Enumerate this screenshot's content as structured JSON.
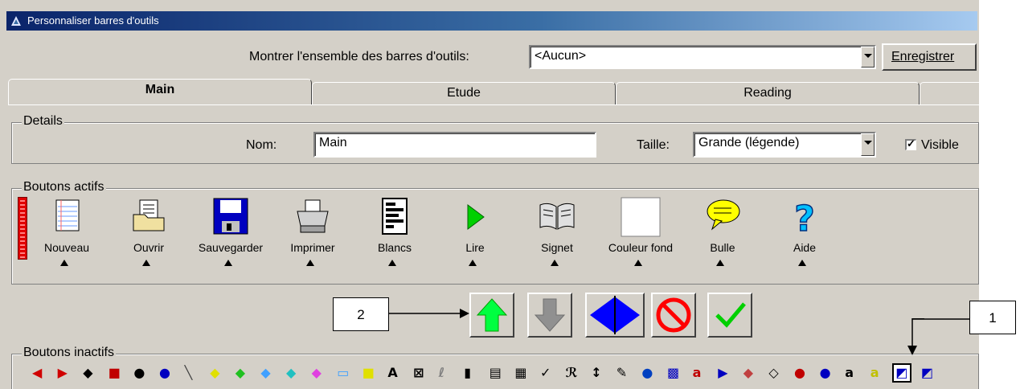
{
  "window": {
    "title": "Personnaliser barres d'outils"
  },
  "toolbar_set": {
    "label": "Montrer l'ensemble des barres d'outils:",
    "value": "<Aucun>",
    "save_button": "Enregistrer"
  },
  "tabs": [
    {
      "label": "Main"
    },
    {
      "label": "Etude"
    },
    {
      "label": "Reading"
    }
  ],
  "details": {
    "title": "Details",
    "name_label": "Nom:",
    "name_value": "Main",
    "size_label": "Taille:",
    "size_value": "Grande (légende)",
    "visible_label": "Visible",
    "visible_checked": true
  },
  "active_buttons": {
    "title": "Boutons actifs",
    "items": [
      {
        "label": "Nouveau",
        "icon": "new-document-icon"
      },
      {
        "label": "Ouvrir",
        "icon": "open-folder-icon"
      },
      {
        "label": "Sauvegarder",
        "icon": "floppy-disk-icon"
      },
      {
        "label": "Imprimer",
        "icon": "printer-icon"
      },
      {
        "label": "Blancs",
        "icon": "blanks-icon"
      },
      {
        "label": "Lire",
        "icon": "play-icon"
      },
      {
        "label": "Signet",
        "icon": "book-icon"
      },
      {
        "label": "Couleur fond",
        "icon": "background-color-icon"
      },
      {
        "label": "Bulle",
        "icon": "speech-bubble-icon"
      },
      {
        "label": "Aide",
        "icon": "help-icon"
      }
    ]
  },
  "action_buttons": [
    {
      "name": "move-up-button",
      "icon": "green-up-arrow-icon"
    },
    {
      "name": "move-down-button",
      "icon": "gray-down-arrow-icon"
    },
    {
      "name": "separator-button",
      "icon": "blue-left-right-arrows-icon"
    },
    {
      "name": "remove-button",
      "icon": "no-sign-icon"
    },
    {
      "name": "apply-button",
      "icon": "green-check-icon"
    }
  ],
  "callouts": {
    "one": "1",
    "two": "2"
  },
  "inactive_buttons": {
    "title": "Boutons inactifs",
    "icons": [
      "rewind-icon",
      "fast-forward-icon",
      "audio-icon",
      "pause-icon",
      "link-icon",
      "color-link-icon",
      "pen-icon",
      "highlighter-yellow-icon",
      "highlighter-green-icon",
      "highlighter-blue-icon",
      "highlighter-teal-icon",
      "highlighter-pink-icon",
      "rectangle-icon",
      "note-icon",
      "text-icon",
      "clear-icon",
      "pencil-icon",
      "trash-icon",
      "columns-icon",
      "grid-icon",
      "spell-check-icon",
      "search-icon",
      "sort-icon",
      "wrench-icon",
      "globe-icon",
      "calculator-icon",
      "abc-icon",
      "color-arrow-icon",
      "eraser-icon",
      "eraser2-icon",
      "abc-circle-icon",
      "abc-circle2-icon",
      "abc-stack-icon",
      "abc-color-icon",
      "background-icon",
      "background-red-icon"
    ]
  },
  "colors": {
    "face": "#d4d0c8",
    "title_start": "#0a246a",
    "arrow_green": "#00ff40",
    "arrow_blue": "#0000ff"
  }
}
